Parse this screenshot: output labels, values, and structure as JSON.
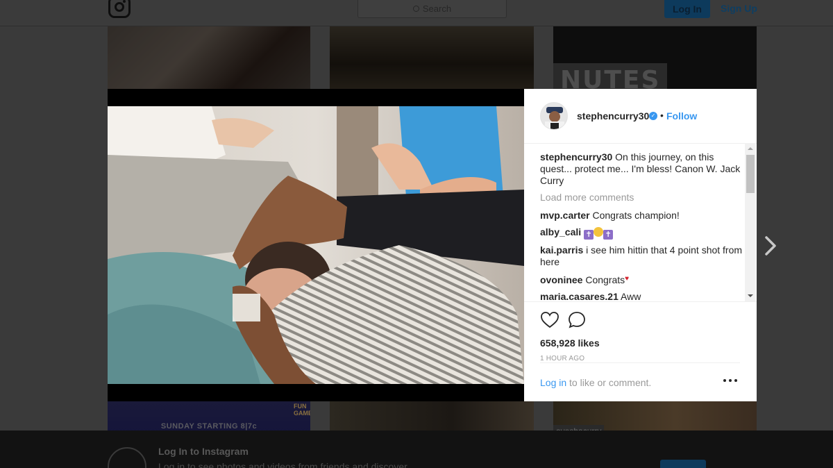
{
  "header": {
    "search_placeholder": "Search",
    "login_label": "Log In",
    "signup_label": "Sign Up"
  },
  "background_tiles": {
    "top_right_text": "NUTES",
    "bottom_left_text": "SUNDAY STARTING 8|7c",
    "bottom_left_logo": "FUN GAMES",
    "bottom_right_tag": "ayeshacurry"
  },
  "footer": {
    "title": "Log In to Instagram",
    "subtitle": "Log in to see photos and videos from friends and discover"
  },
  "post": {
    "username": "stephencurry30",
    "dot": "•",
    "follow_label": "Follow",
    "caption_user": "stephencurry30",
    "caption_text": "On this journey, on this quest... protect me... I'm bless! Canon W. Jack Curry",
    "load_more": "Load more comments",
    "comments": [
      {
        "user": "mvp.carter",
        "text": "Congrats champion!"
      },
      {
        "user": "alby_cali",
        "text": ""
      },
      {
        "user": "kai.parris",
        "text": "i see him hittin that 4 point shot from here"
      },
      {
        "user": "ovoninee",
        "text": "Congrats"
      },
      {
        "user": "maria.casares.21",
        "text": "Aww"
      }
    ],
    "likes": "658,928 likes",
    "time_ago": "1 HOUR AGO",
    "login_link": "Log in",
    "login_suffix": " to like or comment."
  },
  "icons": {
    "heart": "heart-icon",
    "comment": "comment-bubble-icon",
    "more": "more-options-icon",
    "next": "chevron-right-icon",
    "verified": "verified-badge-icon"
  },
  "colors": {
    "accent": "#3897f0",
    "text": "#262626",
    "muted": "#999999"
  }
}
